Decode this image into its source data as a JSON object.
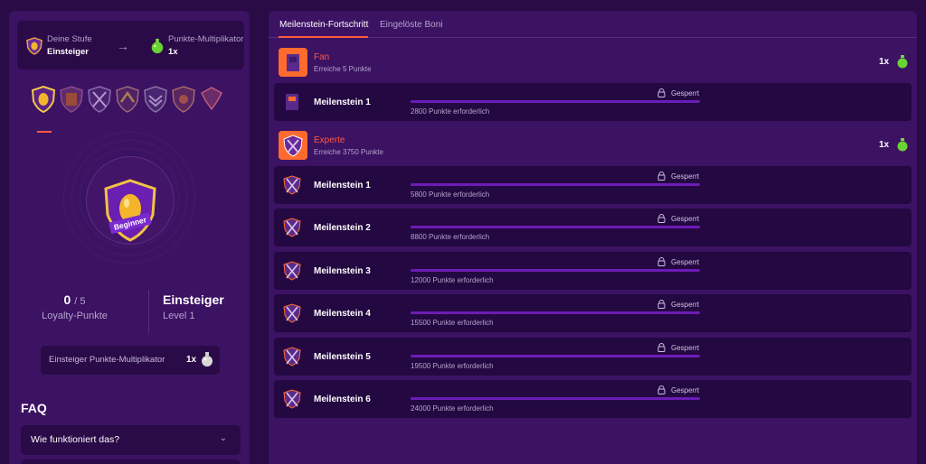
{
  "rank": {
    "stage_label": "Deine Stufe",
    "stage_value": "Einsteiger",
    "mult_label": "Punkte-Multiplikator",
    "mult_value": "1x"
  },
  "shield_badge": "Beginner",
  "stats": {
    "points": "0",
    "points_total": "/ 5",
    "points_label": "Loyalty-Punkte",
    "level_name": "Einsteiger",
    "level_sub": "Level 1"
  },
  "multiplier_box": {
    "label": "Einsteiger Punkte-Multiplikator",
    "value": "1x"
  },
  "faq": {
    "title": "FAQ",
    "items": [
      {
        "q": "Wie funktioniert das?"
      }
    ]
  },
  "tabs": [
    {
      "label": "Meilenstein-Fortschritt",
      "active": true
    },
    {
      "label": "Eingelöste Boni",
      "active": false
    }
  ],
  "groups": [
    {
      "title": "Fan",
      "subtitle": "Erreiche 5 Punkte",
      "mult": "1x",
      "milestones": [
        {
          "name": "Meilenstein 1",
          "lock": "Gesperrt",
          "req": "2800 Punkte erforderlich",
          "progress": 0
        }
      ]
    },
    {
      "title": "Experte",
      "subtitle": "Erreiche 3750 Punkte",
      "mult": "1x",
      "milestones": [
        {
          "name": "Meilenstein 1",
          "lock": "Gesperrt",
          "req": "5800 Punkte erforderlich",
          "progress": 0
        },
        {
          "name": "Meilenstein 2",
          "lock": "Gesperrt",
          "req": "8800 Punkte erforderlich",
          "progress": 0
        },
        {
          "name": "Meilenstein 3",
          "lock": "Gesperrt",
          "req": "12000 Punkte erforderlich",
          "progress": 0
        },
        {
          "name": "Meilenstein 4",
          "lock": "Gesperrt",
          "req": "15500 Punkte erforderlich",
          "progress": 0
        },
        {
          "name": "Meilenstein 5",
          "lock": "Gesperrt",
          "req": "19500 Punkte erforderlich",
          "progress": 0
        },
        {
          "name": "Meilenstein 6",
          "lock": "Gesperrt",
          "req": "24000 Punkte erforderlich",
          "progress": 0
        }
      ]
    }
  ],
  "colors": {
    "accent": "#ff5a3c",
    "panel": "#3c1263",
    "bg": "#2a0b45",
    "row": "#240841",
    "bar": "#6c1cb6"
  }
}
